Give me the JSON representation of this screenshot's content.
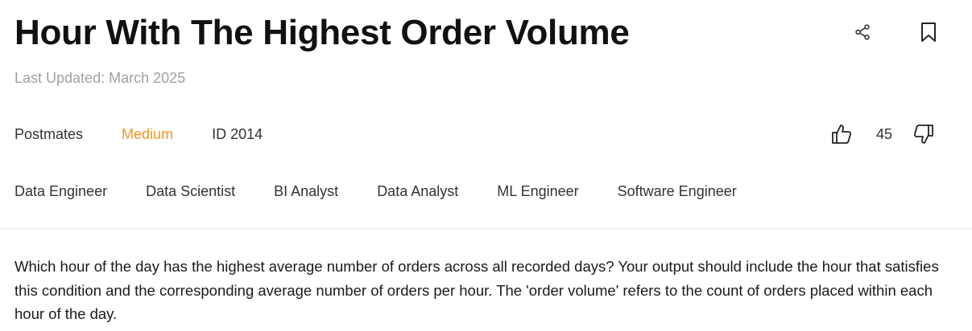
{
  "question": {
    "title": "Hour With The Highest Order Volume",
    "last_updated": "Last Updated: March 2025",
    "company": "Postmates",
    "difficulty": "Medium",
    "id_label": "ID 2014",
    "votes": "45",
    "roles": [
      "Data Engineer",
      "Data Scientist",
      "BI Analyst",
      "Data Analyst",
      "ML Engineer",
      "Software Engineer"
    ],
    "description": "Which hour of the day has the highest average number of orders across all recorded days? Your output should include the hour that satisfies this condition and the corresponding average number of orders per hour. The 'order volume' refers to the count of orders placed within each hour of the day."
  },
  "icons": {
    "share": "share-icon",
    "bookmark": "bookmark-icon",
    "upvote": "thumbs-up-icon",
    "downvote": "thumbs-down-icon"
  },
  "colors": {
    "difficulty": "#f7931e",
    "muted": "#a0a0a0",
    "divider": "#e6e6e6"
  }
}
